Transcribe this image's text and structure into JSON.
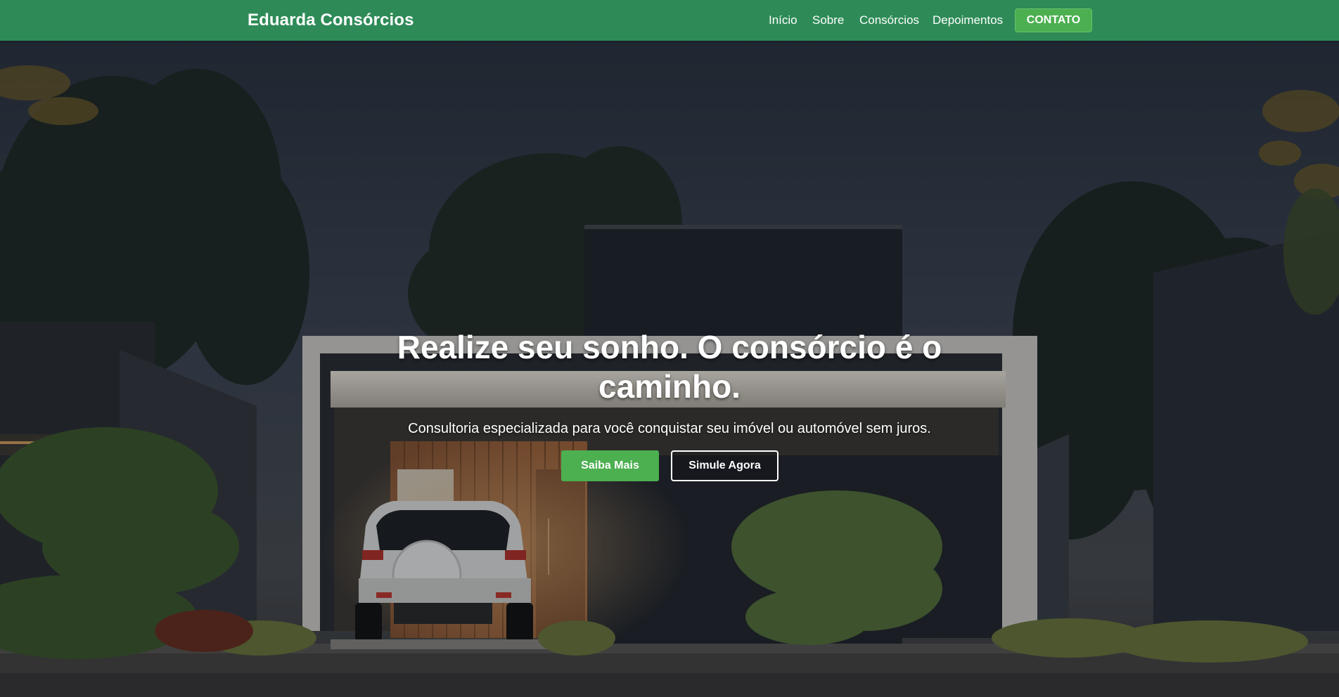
{
  "navbar": {
    "brand": "Eduarda Consórcios",
    "links": [
      {
        "label": "Início"
      },
      {
        "label": "Sobre"
      },
      {
        "label": "Consórcios"
      },
      {
        "label": "Depoimentos"
      }
    ],
    "cta_label": "CONTATO",
    "background_color": "#2e8b57",
    "cta_color": "#4caf50"
  },
  "hero": {
    "title": "Realize seu sonho. O consórcio é o caminho.",
    "subtitle": "Consultoria especializada para você conquistar seu imóvel ou automóvel sem juros.",
    "primary_button_label": "Saiba Mais",
    "secondary_button_label": "Simule Agora"
  }
}
